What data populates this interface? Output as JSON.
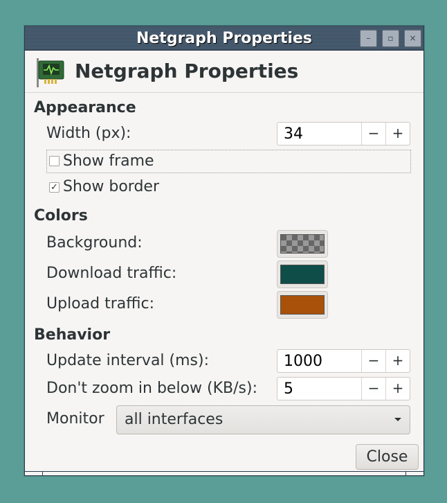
{
  "window": {
    "title": "Netgraph Properties",
    "minimize_icon": "minimize-icon",
    "maximize_icon": "maximize-icon",
    "close_icon": "close-icon"
  },
  "header": {
    "icon": "network-card-icon",
    "title": "Netgraph Properties"
  },
  "appearance": {
    "heading": "Appearance",
    "width_label": "Width (px):",
    "width_value": "34",
    "show_frame_label": "Show frame",
    "show_frame_checked": false,
    "show_border_label": "Show border",
    "show_border_checked": true
  },
  "colors": {
    "heading": "Colors",
    "background_label": "Background:",
    "background_color": "transparent",
    "download_label": "Download traffic:",
    "download_color": "#0e4d48",
    "upload_label": "Upload traffic:",
    "upload_color": "#a9500a"
  },
  "behavior": {
    "heading": "Behavior",
    "update_label": "Update interval (ms):",
    "update_value": "1000",
    "zoom_label": "Don't zoom in below (KB/s):",
    "zoom_value": "5",
    "monitor_label": "Monitor",
    "monitor_value": "all interfaces"
  },
  "spin_symbols": {
    "minus": "−",
    "plus": "+"
  },
  "buttons": {
    "close": "Close"
  }
}
